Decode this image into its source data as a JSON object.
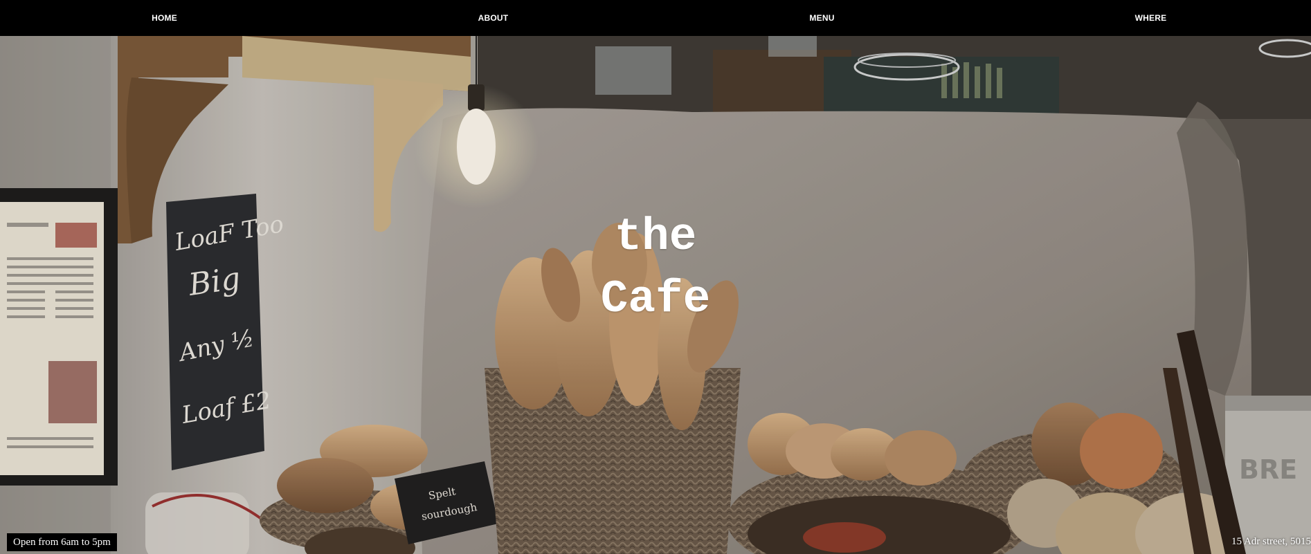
{
  "nav": {
    "items": [
      {
        "label": "HOME"
      },
      {
        "label": "ABOUT"
      },
      {
        "label": "MENU"
      },
      {
        "label": "WHERE"
      }
    ]
  },
  "hero": {
    "title_line_1": "the",
    "title_line_2": "Cafe",
    "chalkboard_text": [
      "LoaF Too",
      "Big",
      "Any ½",
      "Loaf £2"
    ],
    "sign_text": [
      "Spelt",
      "sourdough"
    ]
  },
  "footer": {
    "hours": "Open from 6am to 5pm",
    "address": "15 Adr street, 5015"
  },
  "colors": {
    "nav_background": "#000000",
    "nav_text": "#ffffff",
    "title_text": "#ffffff",
    "badge_background": "#000000"
  }
}
